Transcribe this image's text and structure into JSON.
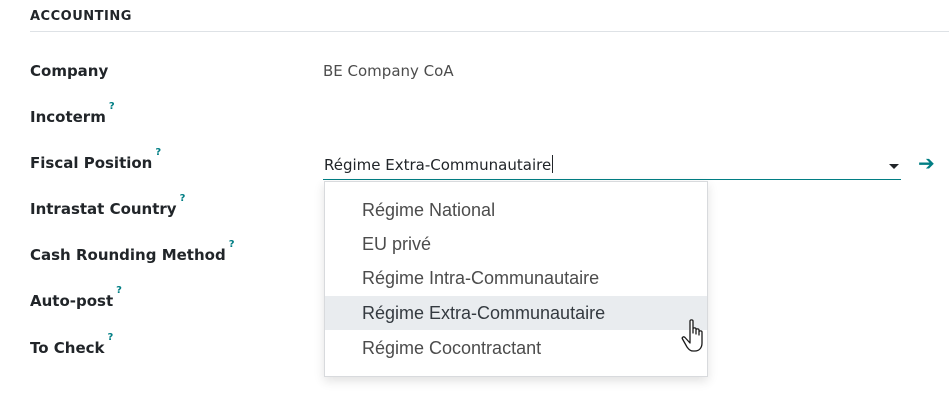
{
  "section": {
    "title": "ACCOUNTING"
  },
  "fields": {
    "company": {
      "label": "Company",
      "value": "BE Company CoA"
    },
    "incoterm": {
      "label": "Incoterm",
      "help": "?"
    },
    "fiscal_position": {
      "label": "Fiscal Position",
      "help": "?",
      "value": "Régime Extra-Communautaire"
    },
    "intrastat_country": {
      "label": "Intrastat Country",
      "help": "?"
    },
    "cash_rounding_method": {
      "label": "Cash Rounding Method",
      "help": "?"
    },
    "auto_post": {
      "label": "Auto-post",
      "help": "?"
    },
    "to_check": {
      "label": "To Check",
      "help": "?"
    }
  },
  "dropdown": {
    "options": [
      "Régime National",
      "EU privé",
      "Régime Intra-Communautaire",
      "Régime Extra-Communautaire",
      "Régime Cocontractant"
    ],
    "hovered_index": 3
  },
  "icons": {
    "dropdown_toggle": "caret-down-icon",
    "internal_link": "arrow-right-icon",
    "cursor": "pointer-hand-cursor-icon"
  },
  "colors": {
    "accent": "#017e84",
    "hover_bg": "#e9ecef",
    "label_text": "#212529",
    "value_text": "#4c4c4c"
  }
}
